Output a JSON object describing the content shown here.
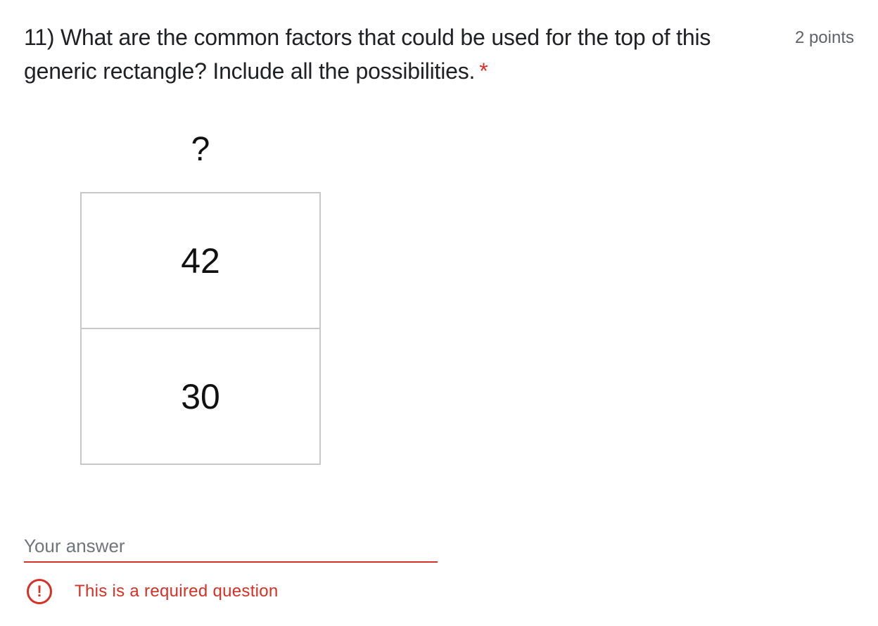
{
  "question": {
    "title": "11) What are the common factors that could be used for the top of this generic rectangle? Include all the possibilities.",
    "required_marker": "*",
    "points": "2 points"
  },
  "figure": {
    "top_label": "?",
    "cells": [
      "42",
      "30"
    ]
  },
  "answer": {
    "placeholder": "Your answer",
    "value": ""
  },
  "validation": {
    "icon": "error-icon",
    "icon_glyph": "!",
    "message": "This is a required question",
    "color": "#d93025"
  }
}
